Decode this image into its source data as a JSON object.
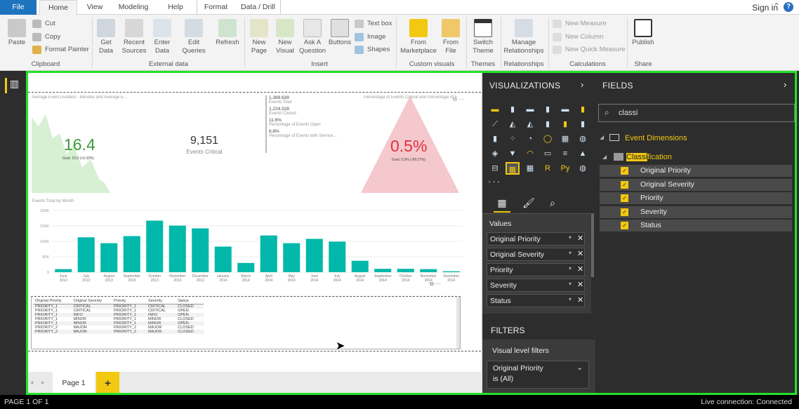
{
  "tabs": [
    "File",
    "Home",
    "View",
    "Modeling",
    "Help",
    "Format",
    "Data / Drill"
  ],
  "signin": "Sign in",
  "ribbon": {
    "clipboard": {
      "paste": "Paste",
      "cut": "Cut",
      "copy": "Copy",
      "format_painter": "Format Painter",
      "group": "Clipboard"
    },
    "external": {
      "get_data": "Get Data",
      "recent_sources": "Recent Sources",
      "enter_data": "Enter Data",
      "edit_queries": "Edit Queries",
      "refresh": "Refresh",
      "group": "External data"
    },
    "insert": {
      "new_page": "New Page",
      "new_visual": "New Visual",
      "ask_question": "Ask A Question",
      "buttons": "Buttons",
      "text_box": "Text box",
      "image": "Image",
      "shapes": "Shapes",
      "group": "Insert"
    },
    "custom": {
      "from_marketplace": "From Marketplace",
      "from_file": "From File",
      "group": "Custom visuals"
    },
    "themes": {
      "switch_theme": "Switch Theme",
      "group": "Themes"
    },
    "relationships": {
      "manage": "Manage Relationships",
      "group": "Relationships"
    },
    "calculations": {
      "new_measure": "New Measure",
      "new_column": "New Column",
      "new_quick_measure": "New Quick Measure",
      "group": "Calculations"
    },
    "share": {
      "publish": "Publish",
      "group": "Share"
    }
  },
  "report": {
    "area1_title": "Average Event Duration - Minutes and Average E...",
    "kpi1_value": "16.4",
    "kpi1_goal": "Goal: 15.0 (+9.33%)",
    "card_value": "9,151",
    "card_label": "Events Critical",
    "multi": [
      {
        "value": "1,369,639",
        "label": "Events Total"
      },
      {
        "value": "1,224,528",
        "label": "Events Closed"
      },
      {
        "value": "11.6%",
        "label": "Percentage of Events Open"
      },
      {
        "value": "6.8%",
        "label": "Percentage of Events with Service..."
      }
    ],
    "area2_title": "Percentage of Events Critical and Percentage of E...",
    "kpi2_value": "0.5%",
    "kpi2_goal": "Goal: 5.0% (-89.27%)",
    "table_headers": [
      "Original Priority",
      "Original Severity",
      "Priority",
      "Severity",
      "Status"
    ],
    "table_rows": [
      [
        "PRIORITY_1",
        "CRITICAL",
        "PRIORITY_1",
        "CRITICAL",
        "CLOSED"
      ],
      [
        "PRIORITY_1",
        "CRITICAL",
        "PRIORITY_1",
        "CRITICAL",
        "OPEN"
      ],
      [
        "PRIORITY_1",
        "INFO",
        "PRIORITY_1",
        "INFO",
        "OPEN"
      ],
      [
        "PRIORITY_1",
        "MINOR",
        "PRIORITY_1",
        "MINOR",
        "CLOSED"
      ],
      [
        "PRIORITY_1",
        "MINOR",
        "PRIORITY_1",
        "MINOR",
        "OPEN"
      ],
      [
        "PRIORITY_2",
        "MAJOR",
        "PRIORITY_2",
        "MAJOR",
        "CLOSED"
      ],
      [
        "PRIORITY_2",
        "MAJOR",
        "PRIORITY_2",
        "MAJOR",
        "CLOSED"
      ]
    ]
  },
  "chart_data": {
    "type": "bar",
    "title": "Events Total by Month",
    "categories": [
      "June 2013",
      "July 2013",
      "August 2013",
      "September 2013",
      "October 2013",
      "November 2013",
      "December 2013",
      "January 2014",
      "March 2014",
      "April 2014",
      "May 2014",
      "June 2014",
      "July 2014",
      "August 2014",
      "September 2014",
      "October 2014",
      "November 2014",
      "December 2014"
    ],
    "values": [
      10000,
      113000,
      94000,
      117000,
      167000,
      151000,
      142000,
      83000,
      30000,
      119000,
      94000,
      108000,
      99000,
      37000,
      11000,
      11000,
      10000,
      3000
    ],
    "yticks": [
      "0",
      "50K",
      "100K",
      "150K",
      "200K"
    ],
    "ylim": [
      0,
      200000
    ],
    "color": "#01b8aa"
  },
  "page_tab": "Page 1",
  "visualizations": {
    "title": "VISUALIZATIONS",
    "values_label": "Values",
    "wells": [
      "Original Priority",
      "Original Severity",
      "Priority",
      "Severity",
      "Status"
    ]
  },
  "filters": {
    "title": "FILTERS",
    "visual_level": "Visual level filters",
    "filter_field": "Original Priority",
    "filter_value": "is (All)"
  },
  "fields": {
    "title": "FIELDS",
    "search_value": "classi",
    "table": "Event Dimensions",
    "folder": "Classification",
    "items": [
      "Original Priority",
      "Original Severity",
      "Priority",
      "Severity",
      "Status"
    ]
  },
  "status": {
    "page": "PAGE 1 OF 1",
    "connection": "Live connection: Connected"
  },
  "colors": {
    "accent": "#f2c811",
    "teal": "#01b8aa",
    "green_kpi": "#d7f0d4",
    "red_kpi": "#f4c8cd",
    "frame": "#22e22a"
  }
}
